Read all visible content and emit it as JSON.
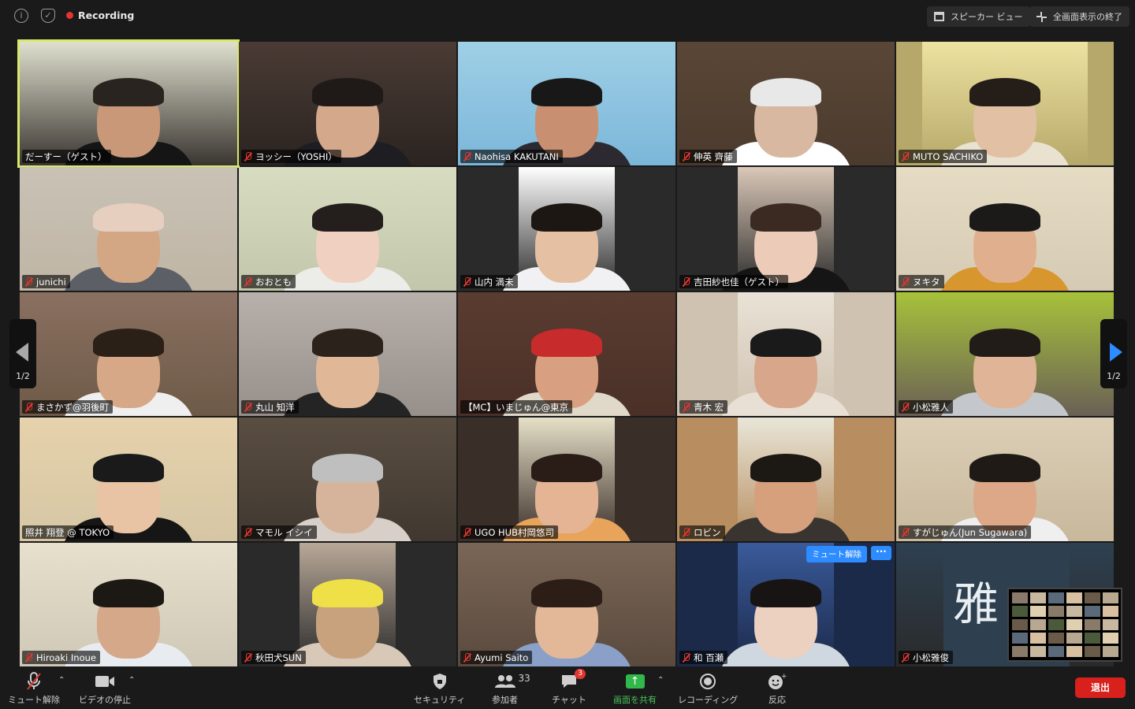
{
  "topbar": {
    "recording_label": "Recording",
    "speaker_view_label": "スピーカー ビュー",
    "exit_fullscreen_label": "全画面表示の終了"
  },
  "pagination": {
    "left_label": "1/2",
    "right_label": "1/2"
  },
  "participants": [
    {
      "name": "だーすー（ゲスト）",
      "muted": false,
      "active": true,
      "bg": "#3a3530",
      "skin": "#c89878",
      "hair": "#2a2420",
      "shirt": "#151515",
      "scene": "#dfe0cf"
    },
    {
      "name": "ヨッシー（YOSHI）",
      "muted": true,
      "bg": "#2b2421",
      "skin": "#d4a88a",
      "hair": "#1f1a18",
      "shirt": "#1d1d22",
      "scene": "#4a3b34"
    },
    {
      "name": "Naohisa KAKUTANI",
      "muted": true,
      "bg": "#7bb6d9",
      "skin": "#c89070",
      "hair": "#181818",
      "shirt": "#2c2a30",
      "scene": "#9fd0e6"
    },
    {
      "name": "伸英 齊藤",
      "muted": true,
      "bg": "#4b3b2e",
      "skin": "#d8b8a0",
      "hair": "#e8e8e8",
      "shirt": "#ffffff",
      "scene": "#5a4636"
    },
    {
      "name": "MUTO SACHIKO",
      "muted": true,
      "bg": "#b6a86a",
      "skin": "#e2c0a4",
      "hair": "#241d18",
      "shirt": "#e9e2d0",
      "scene": "#ede2a0"
    },
    {
      "name": "junichi",
      "muted": true,
      "bg": "#bfb5a5",
      "skin": "#d3a784",
      "hair": "#e7cfc0",
      "shirt": "#5c5f66",
      "scene": "#c9c2b5"
    },
    {
      "name": "おおとも",
      "muted": true,
      "bg": "#c2c6ab",
      "skin": "#f0d0c0",
      "hair": "#241e1c",
      "shirt": "#ecece8",
      "scene": "#d8dcc0"
    },
    {
      "name": "山内 満未",
      "muted": true,
      "bg": "#2a2a2a",
      "skin": "#e6c0a2",
      "hair": "#1d1714",
      "shirt": "#f1f1f4",
      "scene": "#ffffff"
    },
    {
      "name": "吉田紗也佳（ゲスト）",
      "muted": true,
      "bg": "#2a2a2a",
      "skin": "#ecccb8",
      "hair": "#3a2a22",
      "shirt": "#151515",
      "scene": "#dac8b8"
    },
    {
      "name": "ヌキタ",
      "muted": true,
      "bg": "#d5cbb4",
      "skin": "#e0b08e",
      "hair": "#1c1a18",
      "shirt": "#d8962e",
      "scene": "#e6dcc4"
    },
    {
      "name": "まさかず@羽後町",
      "muted": true,
      "bg": "#6e5a48",
      "skin": "#d6a888",
      "hair": "#2a2018",
      "shirt": "#efefef",
      "scene": "#8a7060"
    },
    {
      "name": "丸山 知洋",
      "muted": true,
      "bg": "#978f8a",
      "skin": "#e0b898",
      "hair": "#2c221c",
      "shirt": "#242424",
      "scene": "#b8b0aa"
    },
    {
      "name": "【MC】いまじゅん@東京",
      "muted": false,
      "bg": "#4a3028",
      "skin": "#d8a080",
      "hair": "#c82b2b",
      "shirt": "#e0d8c8",
      "scene": "#5a3c30"
    },
    {
      "name": "青木 宏",
      "muted": true,
      "bg": "#cfc2b0",
      "skin": "#d8a68a",
      "hair": "#1a1a1a",
      "shirt": "#e8e0d4",
      "scene": "#e9e2d6"
    },
    {
      "name": "小松雅人",
      "muted": true,
      "bg": "#6a6056",
      "skin": "#e0b496",
      "hair": "#221c18",
      "shirt": "#c4c8cc",
      "scene": "#a7c23a"
    },
    {
      "name": "照井 翔登 @ TOKYO",
      "muted": false,
      "bg": "#d6c6a4",
      "skin": "#e8c4a4",
      "hair": "#1a1a1a",
      "shirt": "#161616",
      "scene": "#e6d2ac"
    },
    {
      "name": "マモル イシイ",
      "muted": true,
      "bg": "#403830",
      "skin": "#d6b49c",
      "hair": "#bfbfbf",
      "shirt": "#d8d0c8",
      "scene": "#5a4e42"
    },
    {
      "name": "UGO HUB村岡悠司",
      "muted": true,
      "bg": "#3a2e28",
      "skin": "#e4b494",
      "hair": "#2a1c16",
      "shirt": "#e8a45a",
      "scene": "#e6e0c8"
    },
    {
      "name": "ロビン",
      "muted": true,
      "bg": "#b88e60",
      "skin": "#d6a07c",
      "hair": "#1c1814",
      "shirt": "#3a3430",
      "scene": "#e8e6d8"
    },
    {
      "name": "すがじゅん(Jun Sugawara)",
      "muted": true,
      "bg": "#c8b89c",
      "skin": "#dca888",
      "hair": "#201a16",
      "shirt": "#efefef",
      "scene": "#dccfb6"
    },
    {
      "name": "Hiroaki Inoue",
      "muted": true,
      "bg": "#cfc8b6",
      "skin": "#d4a888",
      "hair": "#1c1814",
      "shirt": "#e8ecf0",
      "scene": "#e6e0cc"
    },
    {
      "name": "秋田犬SUN",
      "muted": true,
      "bg": "#2a2a2a",
      "skin": "#c8a27c",
      "hair": "#efe048",
      "shirt": "#d8c8b8",
      "scene": "#b8a898"
    },
    {
      "name": "Ayumi Saito",
      "muted": true,
      "bg": "#5a4a3e",
      "skin": "#e2b898",
      "hair": "#2c1e16",
      "shirt": "#8aa0c8",
      "scene": "#7a6656"
    },
    {
      "name": "和 百瀬",
      "muted": true,
      "bg": "#1c2a4a",
      "skin": "#ecd0c0",
      "hair": "#181414",
      "shirt": "#cfd8e0",
      "scene": "#3a5a9a"
    },
    {
      "name": "小松雅俊",
      "muted": true,
      "bg": "#2a2a2a",
      "skin": "#2a3a48",
      "hair": "#2a3a48",
      "shirt": "#2a3a48",
      "scene": "#2e4050"
    }
  ],
  "tile_overlay": {
    "unmute_label": "ミュート解除",
    "more_label": "···"
  },
  "name_card_text": "雅",
  "toolbar": {
    "unmute_label": "ミュート解除",
    "video_stop_label": "ビデオの停止",
    "security_label": "セキュリティ",
    "participants_label": "参加者",
    "participants_count": "33",
    "chat_label": "チャット",
    "chat_badge": "3",
    "share_label": "画面を共有",
    "recording_label": "レコーディング",
    "reaction_label": "反応",
    "leave_label": "退出"
  }
}
